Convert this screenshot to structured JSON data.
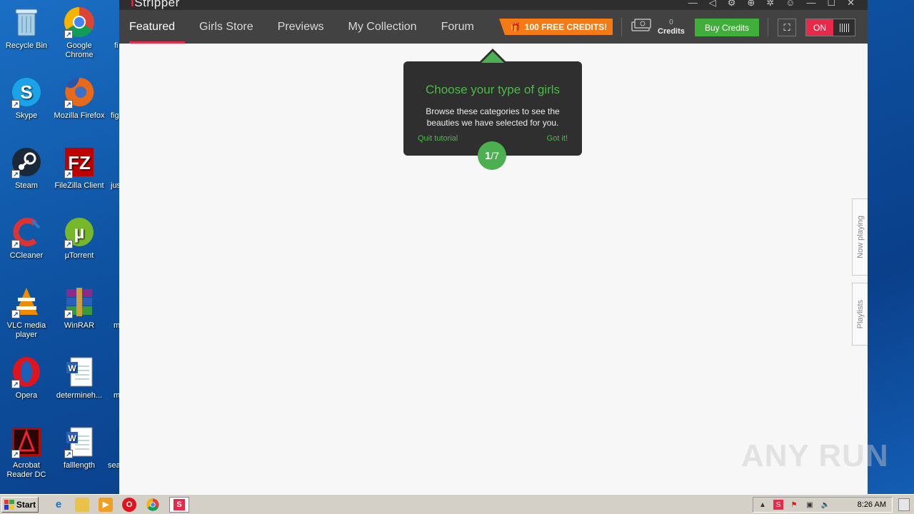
{
  "desktop": {
    "icons": [
      {
        "label": "Recycle Bin",
        "icon": "recycle-bin-icon",
        "color": "#7fb3d9"
      },
      {
        "label": "Google Chrome",
        "icon": "chrome-icon",
        "color": "#f2b20f"
      },
      {
        "label": "Skype",
        "icon": "skype-icon",
        "color": "#1aa3e8"
      },
      {
        "label": "Mozilla Firefox",
        "icon": "firefox-icon",
        "color": "#e66a1a"
      },
      {
        "label": "Steam",
        "icon": "steam-icon",
        "color": "#1b2838"
      },
      {
        "label": "FileZilla Client",
        "icon": "filezilla-icon",
        "color": "#bf0000"
      },
      {
        "label": "CCleaner",
        "icon": "ccleaner-icon",
        "color": "#d33"
      },
      {
        "label": "µTorrent",
        "icon": "utorrent-icon",
        "color": "#77b82a"
      },
      {
        "label": "VLC media player",
        "icon": "vlc-icon",
        "color": "#f08a00"
      },
      {
        "label": "WinRAR",
        "icon": "winrar-icon",
        "color": "#8a2b8a"
      },
      {
        "label": "Opera",
        "icon": "opera-icon",
        "color": "#e0141e"
      },
      {
        "label": "determineh...",
        "icon": "word-doc-icon",
        "color": "#2b5fb8"
      },
      {
        "label": "Acrobat Reader DC",
        "icon": "acrobat-icon",
        "color": "#b30b00"
      },
      {
        "label": "falllength",
        "icon": "word-doc-icon",
        "color": "#2b5fb8"
      }
    ],
    "partial_labels": [
      "fi",
      "fig",
      "jus",
      "m",
      "m",
      "sea"
    ]
  },
  "app": {
    "logo_prefix": "i",
    "logo_text": "Stripper",
    "nav": [
      {
        "label": "Featured",
        "active": true
      },
      {
        "label": "Girls Store",
        "active": false
      },
      {
        "label": "Previews",
        "active": false
      },
      {
        "label": "My Collection",
        "active": false
      },
      {
        "label": "Forum",
        "active": false
      }
    ],
    "free_credits_label": "100 FREE CREDITS!",
    "credits_count": "0",
    "credits_label": "Credits",
    "buy_credits_label": "Buy Credits",
    "toggle_label": "ON",
    "accent_color": "#e8294a",
    "green_color": "#4caf50"
  },
  "tooltip": {
    "title": "Choose your type of girls",
    "body": "Browse these categories to see the beauties we have selected for you.",
    "quit_label": "Quit tutorial",
    "got_it_label": "Got it!",
    "step_current": "1",
    "step_total": "/7"
  },
  "side_tabs": {
    "now_playing": "Now playing",
    "playlists": "Playlists"
  },
  "watermark": "ANY RUN",
  "taskbar": {
    "start_label": "Start",
    "clock": "8:26 AM"
  }
}
